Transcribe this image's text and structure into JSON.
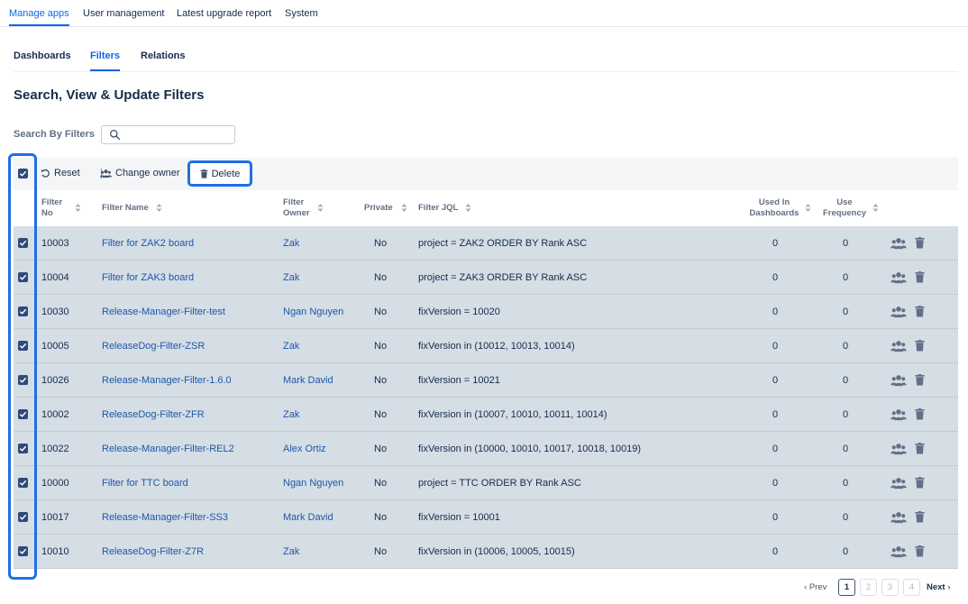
{
  "topnav": {
    "tabs": [
      "Manage apps",
      "User management",
      "Latest upgrade report",
      "System"
    ],
    "active": "Manage apps"
  },
  "subtabs": {
    "tabs": [
      "Dashboards",
      "Filters",
      "Relations"
    ],
    "active": "Filters"
  },
  "page_title": "Search, View & Update Filters",
  "search": {
    "label": "Search By Filters",
    "value": "",
    "placeholder": ""
  },
  "toolbar": {
    "reset_label": "Reset",
    "change_owner_label": "Change owner",
    "delete_label": "Delete"
  },
  "table": {
    "headers": {
      "filter_no_1": "Filter",
      "filter_no_2": "No",
      "filter_name": "Filter Name",
      "filter_owner_1": "Filter",
      "filter_owner_2": "Owner",
      "private": "Private",
      "filter_jql": "Filter JQL",
      "used_1": "Used In",
      "used_2": "Dashboards",
      "freq_1": "Use",
      "freq_2": "Frequency"
    },
    "rows": [
      {
        "no": "10003",
        "name": "Filter for ZAK2 board",
        "owner": "Zak",
        "private": "No",
        "jql": "project = ZAK2 ORDER BY Rank ASC",
        "used": "0",
        "freq": "0",
        "checked": true
      },
      {
        "no": "10004",
        "name": "Filter for ZAK3 board",
        "owner": "Zak",
        "private": "No",
        "jql": "project = ZAK3 ORDER BY Rank ASC",
        "used": "0",
        "freq": "0",
        "checked": true
      },
      {
        "no": "10030",
        "name": "Release-Manager-Filter-test",
        "owner": "Ngan Nguyen",
        "private": "No",
        "jql": "fixVersion = 10020",
        "used": "0",
        "freq": "0",
        "checked": true
      },
      {
        "no": "10005",
        "name": "ReleaseDog-Filter-ZSR",
        "owner": "Zak",
        "private": "No",
        "jql": "fixVersion in (10012, 10013, 10014)",
        "used": "0",
        "freq": "0",
        "checked": true
      },
      {
        "no": "10026",
        "name": "Release-Manager-Filter-1.6.0",
        "owner": "Mark David",
        "private": "No",
        "jql": "fixVersion = 10021",
        "used": "0",
        "freq": "0",
        "checked": true
      },
      {
        "no": "10002",
        "name": "ReleaseDog-Filter-ZFR",
        "owner": "Zak",
        "private": "No",
        "jql": "fixVersion in (10007, 10010, 10011, 10014)",
        "used": "0",
        "freq": "0",
        "checked": true
      },
      {
        "no": "10022",
        "name": "Release-Manager-Filter-REL2",
        "owner": "Alex Ortiz",
        "private": "No",
        "jql": "fixVersion in (10000, 10010, 10017, 10018, 10019)",
        "used": "0",
        "freq": "0",
        "checked": true
      },
      {
        "no": "10000",
        "name": "Filter for TTC board",
        "owner": "Ngan Nguyen",
        "private": "No",
        "jql": "project = TTC ORDER BY Rank ASC",
        "used": "0",
        "freq": "0",
        "checked": true
      },
      {
        "no": "10017",
        "name": "Release-Manager-Filter-SS3",
        "owner": "Mark David",
        "private": "No",
        "jql": "fixVersion = 10001",
        "used": "0",
        "freq": "0",
        "checked": true
      },
      {
        "no": "10010",
        "name": "ReleaseDog-Filter-Z7R",
        "owner": "Zak",
        "private": "No",
        "jql": "fixVersion in (10006, 10005, 10015)",
        "used": "0",
        "freq": "0",
        "checked": true
      }
    ]
  },
  "pagination": {
    "prev": "Prev",
    "pages": [
      "1",
      "2",
      "3",
      "4"
    ],
    "current": "1",
    "next": "Next"
  },
  "colors": {
    "accent": "#0c66e4",
    "row_selected": "#d5dde5",
    "highlight": "#1f6fe5"
  }
}
